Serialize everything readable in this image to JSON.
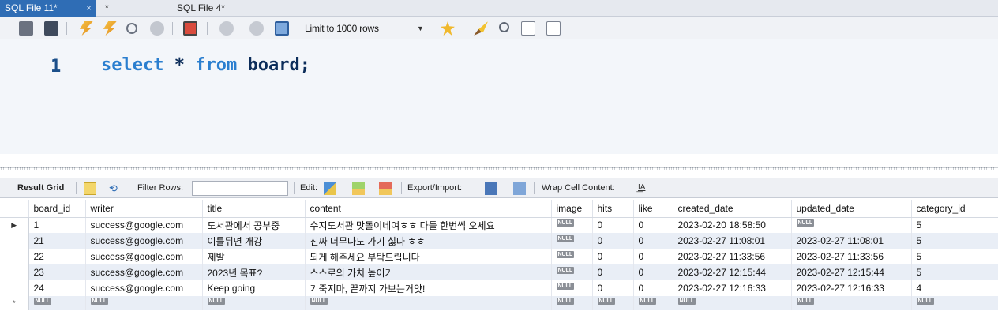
{
  "tabs": [
    {
      "label": "SQL File 11*",
      "active": true,
      "close": "×"
    },
    {
      "label": "*",
      "active": false
    },
    {
      "label": "SQL File 4*",
      "active": false
    }
  ],
  "toolbar": {
    "limit_label": "Limit to 1000 rows",
    "limit_arrow": "▼",
    "icons": [
      "open-folder-icon",
      "save-icon",
      "execute-icon",
      "execute-current-icon",
      "explain-icon",
      "stop-icon",
      "toggle-error-icon",
      "commit-icon",
      "rollback-icon",
      "autocommit-icon",
      "add-snippet-icon",
      "beautify-icon",
      "find-icon",
      "invisible-chars-icon",
      "wrap-icon"
    ],
    "accent": "#2f6db5"
  },
  "editor": {
    "line_number": "1",
    "code_kw1": "select",
    "code_mid": " * ",
    "code_kw2": "from",
    "code_rest": " board;"
  },
  "result_toolbar": {
    "result_grid_label": "Result Grid",
    "filter_label": "Filter Rows:",
    "edit_label": "Edit:",
    "export_label": "Export/Import:",
    "wrap_label": "Wrap Cell Content:",
    "wrap_icon_glyph": "I͟A"
  },
  "table": {
    "columns": [
      "board_id",
      "writer",
      "title",
      "content",
      "image",
      "hits",
      "like",
      "created_date",
      "updated_date",
      "category_id"
    ],
    "current_marker": "▶",
    "new_marker": "*",
    "null_text": "NULL",
    "rows": [
      [
        "1",
        "success@google.com",
        "도서관에서 공부중",
        "수지도서관 맛돌이네여ㅎㅎ 다들 한번씩 오세요",
        null,
        "0",
        "0",
        "2023-02-20 18:58:50",
        null,
        "5"
      ],
      [
        "21",
        "success@google.com",
        "이틀뒤면 개강",
        "진짜 너무나도 가기 싫다 ㅎㅎ",
        null,
        "0",
        "0",
        "2023-02-27 11:08:01",
        "2023-02-27 11:08:01",
        "5"
      ],
      [
        "22",
        "success@google.com",
        "제발",
        "되게 해주세요 부탁드립니다",
        null,
        "0",
        "0",
        "2023-02-27 11:33:56",
        "2023-02-27 11:33:56",
        "5"
      ],
      [
        "23",
        "success@google.com",
        "2023년 목표?",
        "스스로의 가치 높이기",
        null,
        "0",
        "0",
        "2023-02-27 12:15:44",
        "2023-02-27 12:15:44",
        "5"
      ],
      [
        "24",
        "success@google.com",
        "Keep going",
        "기죽지마, 끝까지 가보는거얏!",
        null,
        "0",
        "0",
        "2023-02-27 12:16:33",
        "2023-02-27 12:16:33",
        "4"
      ]
    ]
  }
}
